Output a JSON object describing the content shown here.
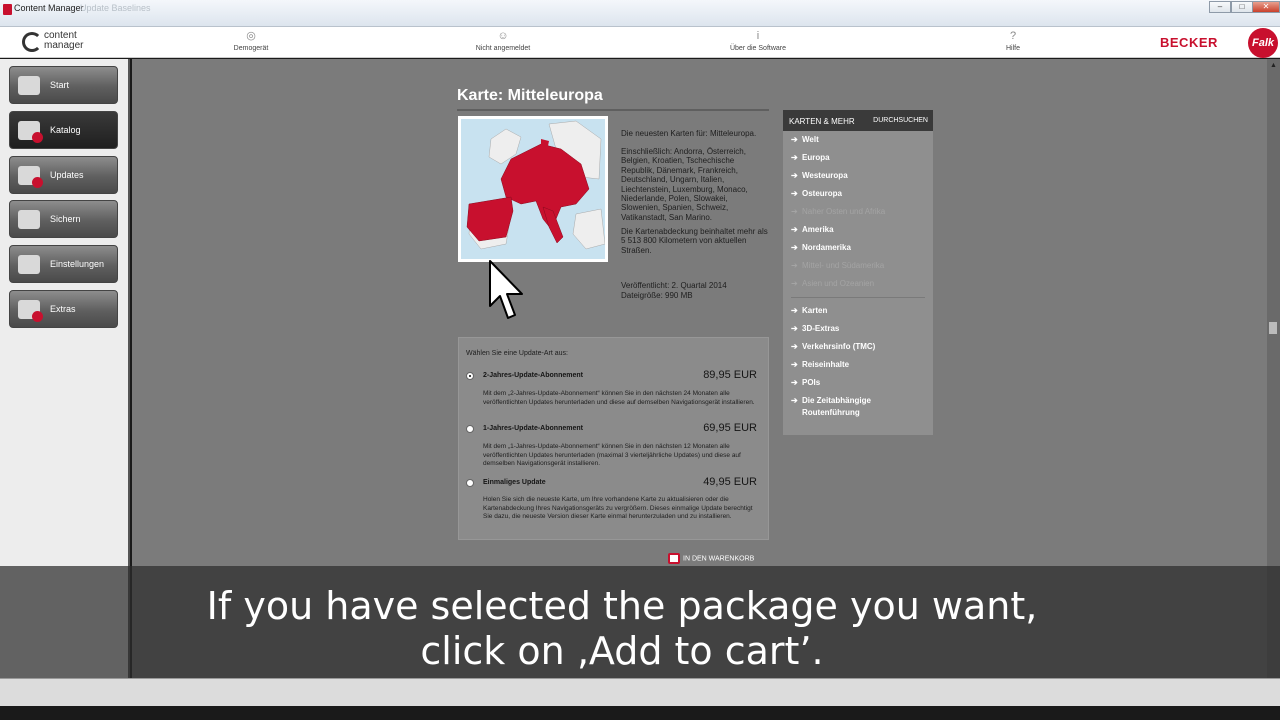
{
  "window": {
    "title": "Content Manager",
    "faded_title": "Update Baselines"
  },
  "header": {
    "logo_line1": "content",
    "logo_line2": "manager",
    "tools": [
      {
        "label": "Demogerät",
        "icon": "device-icon"
      },
      {
        "label": "Nicht angemeldet",
        "icon": "user-icon"
      },
      {
        "label": "Über die Software",
        "icon": "info-icon"
      },
      {
        "label": "Hilfe",
        "icon": "help-icon"
      }
    ],
    "brand": "BECKER",
    "brand2": "Falk"
  },
  "sidebar": {
    "items": [
      {
        "label": "Start"
      },
      {
        "label": "Katalog"
      },
      {
        "label": "Updates"
      },
      {
        "label": "Sichern"
      },
      {
        "label": "Einstellungen"
      },
      {
        "label": "Extras"
      }
    ],
    "active": "Katalog"
  },
  "main": {
    "title": "Karte: Mitteleuropa",
    "desc1": "Die neuesten Karten für: Mitteleuropa.",
    "desc2": "Einschließlich: Andorra, Österreich, Belgien, Kroatien, Tschechische Republik, Dänemark, Frankreich, Deutschland, Ungarn, Italien, Liechtenstein, Luxemburg, Monaco, Niederlande, Polen, Slowakei, Slowenien, Spanien, Schweiz, Vatikanstadt, San Marino.",
    "desc3": "Die Kartenabdeckung beinhaltet mehr als 5 513 800 Kilometern von  aktuellen Straßen.",
    "published": "Veröffentlicht: 2. Quartal 2014",
    "filesize": "Dateigröße: 990 MB",
    "update_prompt": "Wählen Sie eine Update-Art aus:",
    "options": [
      {
        "name": "2-Jahres-Update-Abonnement",
        "price": "89,95 EUR",
        "selected": true,
        "desc": "Mit dem „2-Jahres-Update-Abonnement“ können Sie in den nächsten 24 Monaten alle veröffentlichten Updates herunterladen und diese auf demselben Navigationsgerät installieren."
      },
      {
        "name": "1-Jahres-Update-Abonnement",
        "price": "69,95 EUR",
        "selected": false,
        "desc": "Mit dem „1-Jahres-Update-Abonnement“ können Sie in den nächsten 12 Monaten alle veröffentlichten Updates herunterladen (maximal 3 vierteljährliche Updates) und diese auf demselben Navigationsgerät installieren."
      },
      {
        "name": "Einmaliges Update",
        "price": "49,95 EUR",
        "selected": false,
        "desc": "Holen Sie sich die neueste Karte, um Ihre vorhandene Karte zu aktualisieren oder die Kartenabdeckung Ihres Navigationsgeräts zu vergrößern. Dieses einmalige Update berechtigt Sie dazu, die neueste Version dieser Karte einmal herunterzuladen und zu installieren."
      }
    ],
    "cart_label": "IN DEN WARENKORB"
  },
  "sidebox": {
    "header": "KARTEN & MEHR",
    "header_link": "DURCHSUCHEN",
    "regions": [
      {
        "label": "Welt",
        "dim": false
      },
      {
        "label": "Europa",
        "dim": false
      },
      {
        "label": "Westeuropa",
        "dim": false
      },
      {
        "label": "Osteuropa",
        "dim": false
      },
      {
        "label": "Naher Osten und Afrika",
        "dim": true
      },
      {
        "label": "Amerika",
        "dim": false
      },
      {
        "label": "Nordamerika",
        "dim": false
      },
      {
        "label": "Mittel- und Südamerika",
        "dim": true
      },
      {
        "label": "Asien und Ozeanien",
        "dim": true
      }
    ],
    "categories": [
      {
        "label": "Karten"
      },
      {
        "label": "3D-Extras"
      },
      {
        "label": "Verkehrsinfo (TMC)"
      },
      {
        "label": "Reiseinhalte"
      },
      {
        "label": "POIs"
      },
      {
        "label": "Die Zeitabhängige",
        "label2": "Routenführung"
      }
    ]
  },
  "caption": {
    "line1": "If you have selected the package you want,",
    "line2": "click on ‚Add to cart’."
  },
  "colors": {
    "brand_red": "#c8102e",
    "main_bg": "#7b7b7b"
  }
}
